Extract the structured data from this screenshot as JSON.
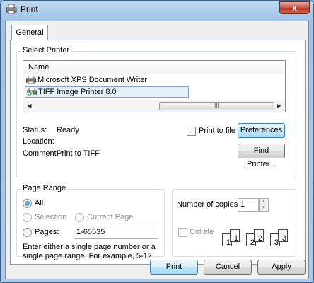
{
  "window": {
    "title": "Print",
    "close_label": "x"
  },
  "tabs": [
    {
      "label": "General"
    }
  ],
  "select_printer": {
    "group_label": "Select Printer",
    "column_header": "Name",
    "printers": [
      {
        "name": "Microsoft XPS Document Writer",
        "icon": "printer-icon"
      },
      {
        "name": "TIFF Image Printer 8.0",
        "icon": "printer-default-icon",
        "selected": true
      }
    ],
    "scroll_thumb_glyph": "III",
    "status_label": "Status:",
    "status_value": "Ready",
    "location_label": "Location:",
    "location_value": "",
    "comment_label": "Comment:",
    "comment_value": "Print to TIFF",
    "print_to_file_label": "Print to file",
    "print_to_file_checked": false,
    "preferences_label": "Preferences",
    "find_printer_label": "Find Printer..."
  },
  "page_range": {
    "group_label": "Page Range",
    "all_label": "All",
    "selection_label": "Selection",
    "current_page_label": "Current Page",
    "pages_label": "Pages:",
    "pages_value": "1-65535",
    "hint": "Enter either a single page number or a single page range.  For example, 5-12",
    "selected": "all"
  },
  "copies": {
    "label": "Number of copies:",
    "value": "1",
    "collate_label": "Collate",
    "collate_checked": false,
    "collate_pages": [
      "1",
      "1",
      "2",
      "2",
      "3",
      "3"
    ]
  },
  "footer": {
    "print_label": "Print",
    "cancel_label": "Cancel",
    "apply_label": "Apply"
  }
}
